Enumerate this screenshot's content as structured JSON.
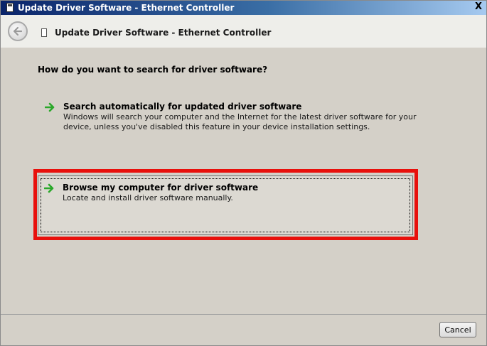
{
  "window": {
    "title": "Update Driver Software - Ethernet Controller",
    "close_glyph": "X"
  },
  "header": {
    "title": "Update Driver Software - Ethernet Controller",
    "back_icon": "back-arrow-icon",
    "device_icon": "device-icon"
  },
  "main": {
    "question": "How do you want to search for driver software?",
    "options": [
      {
        "title": "Search automatically for updated driver software",
        "description": "Windows will search your computer and the Internet for the latest driver software for your\ndevice, unless you've disabled this feature in your device installation settings.",
        "icon": "green-arrow-icon"
      },
      {
        "title": "Browse my computer for driver software",
        "description": "Locate and install driver software manually.",
        "icon": "green-arrow-icon"
      }
    ]
  },
  "footer": {
    "cancel_label": "Cancel"
  },
  "colors": {
    "highlight": "#e8100c",
    "arrow_green": "#2aa82a",
    "dialog_bg": "#d4d0c8"
  }
}
